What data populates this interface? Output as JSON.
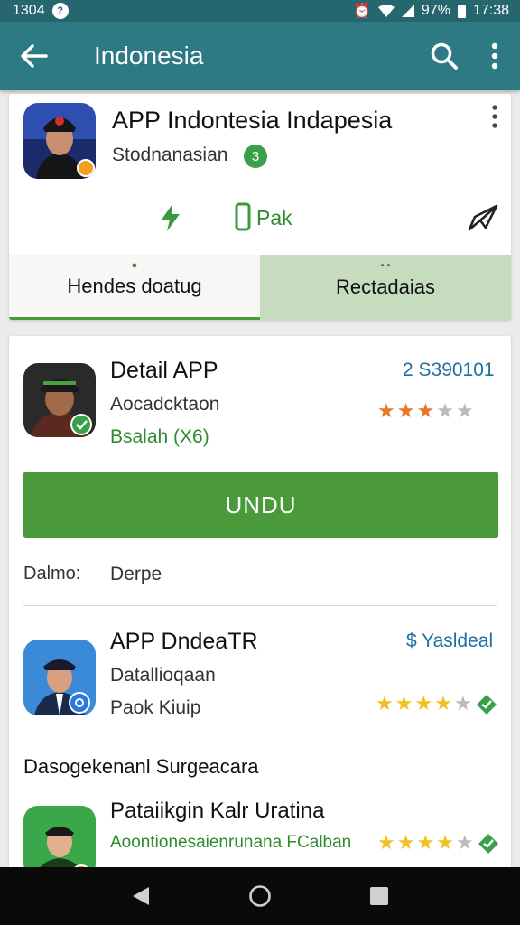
{
  "status_bar": {
    "time_left": "1304",
    "battery": "97%",
    "time_right": "17:38"
  },
  "app_bar": {
    "title": "Indonesia"
  },
  "header_card": {
    "app_name": "APP Indontesia Indapesia",
    "developer": "Stodnanasian",
    "dev_badge": "3",
    "action_label": "Pak",
    "tabs": [
      {
        "label": "Hendes doatug",
        "selected": true
      },
      {
        "label": "Rectadaias",
        "selected": false
      }
    ]
  },
  "list_card": {
    "item1": {
      "title": "Detail APP",
      "subtitle": "Aocadcktaon",
      "meta": "Bsalah (X6)",
      "rating_label": "2 S390101",
      "rating": 3.5,
      "primary_button": "UNDU"
    },
    "detail_row": {
      "label": "Dalmo:",
      "value": "Derpe"
    },
    "item2": {
      "title": "APP  DndeaTR",
      "subtitle": "Datallioqaan",
      "meta": "Paok Kiuip",
      "price": "$ Yasldeal",
      "rating": 4
    },
    "section_heading": "Dasogekenanl Surgeacara",
    "item3": {
      "title": "Pataiikgin Kalr Uratina",
      "subtitle": "Aoontionesaienrunana FCalban",
      "rating": 4
    }
  },
  "colors": {
    "app_bar": "#2e7a84",
    "accent_green": "#4a9a3c",
    "star_orange": "#e8772a",
    "star_yellow": "#f2c11f"
  }
}
